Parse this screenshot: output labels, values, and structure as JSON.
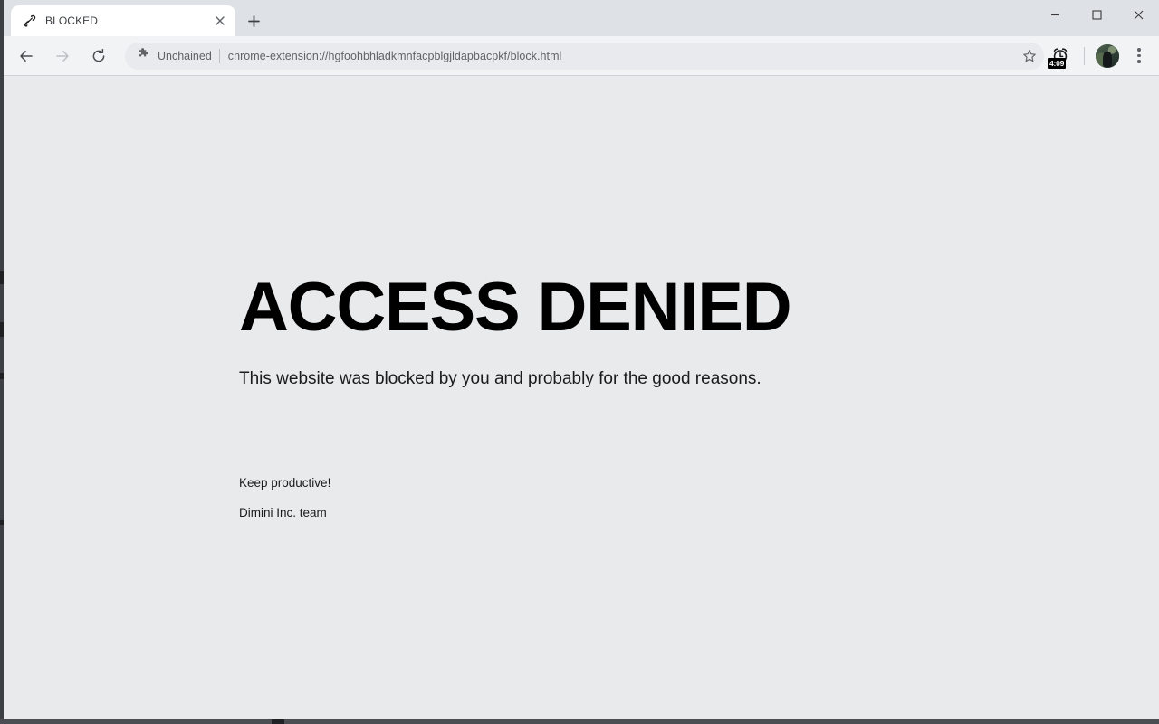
{
  "window": {
    "controls": {
      "minimize_label": "—",
      "maximize_label": "□",
      "close_label": "✕"
    }
  },
  "tabstrip": {
    "tabs": [
      {
        "title": "BLOCKED",
        "favicon": "broken-chain-icon",
        "close_label": "✕",
        "active": true
      }
    ],
    "new_tab_label": "+"
  },
  "toolbar": {
    "back_icon": "arrow-back-icon",
    "forward_icon": "arrow-forward-icon",
    "reload_icon": "reload-icon",
    "omnibox": {
      "extension_icon": "puzzle-piece-icon",
      "extension_name": "Unchained",
      "url": "chrome-extension://hgfoohbhladkmnfacpblgjldapbacpkf/block.html"
    },
    "bookmark_icon": "star-outline-icon",
    "extensions": [
      {
        "icon": "alarm-clock-icon",
        "badge": "4:09"
      }
    ],
    "profile": {
      "icon": "avatar",
      "label": ""
    },
    "menu_icon": "three-dot-menu-icon"
  },
  "page": {
    "headline": "ACCESS DENIED",
    "subhead": "This website was blocked by you and probably for the good reasons.",
    "footer": {
      "line1": "Keep productive!",
      "line2": "Dimini Inc. team"
    }
  },
  "colors": {
    "tabstrip_bg": "#dee1e6",
    "toolbar_bg": "#f1f3f4",
    "page_bg": "#e9eaec",
    "text_primary": "#1b1b1b",
    "text_muted": "#5f6368"
  }
}
